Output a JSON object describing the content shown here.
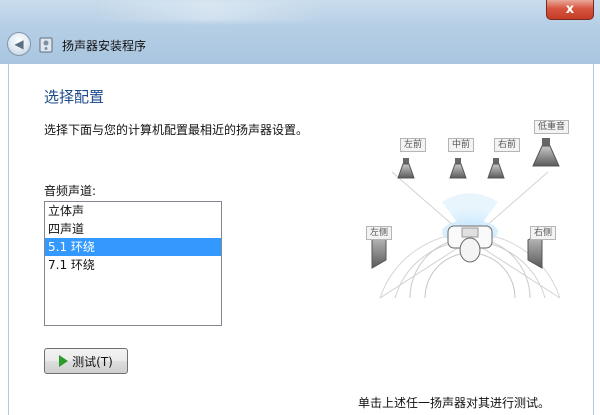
{
  "window": {
    "title": "扬声器安装程序",
    "close_glyph": "x"
  },
  "nav": {
    "back_glyph": "◀"
  },
  "page": {
    "heading": "选择配置",
    "description": "选择下面与您的计算机配置最相近的扬声器设置。"
  },
  "channels": {
    "label": "音频声道:",
    "items": [
      {
        "label": "立体声",
        "selected": false
      },
      {
        "label": "四声道",
        "selected": false
      },
      {
        "label": "5.1 环绕",
        "selected": true
      },
      {
        "label": "7.1 环绕",
        "selected": false
      }
    ]
  },
  "test_button": {
    "label": "测试(T)",
    "icon": "play-icon"
  },
  "speakers": {
    "front_left": "左前",
    "center": "中前",
    "front_right": "右前",
    "subwoofer": "低重音",
    "side_left": "左侧",
    "side_right": "右侧"
  },
  "footer": {
    "hint": "单击上述任一扬声器对其进行测试。"
  },
  "colors": {
    "heading": "#1e4a8c",
    "selection": "#3399ff",
    "close": "#c43c26",
    "play": "#2c9a2c"
  }
}
